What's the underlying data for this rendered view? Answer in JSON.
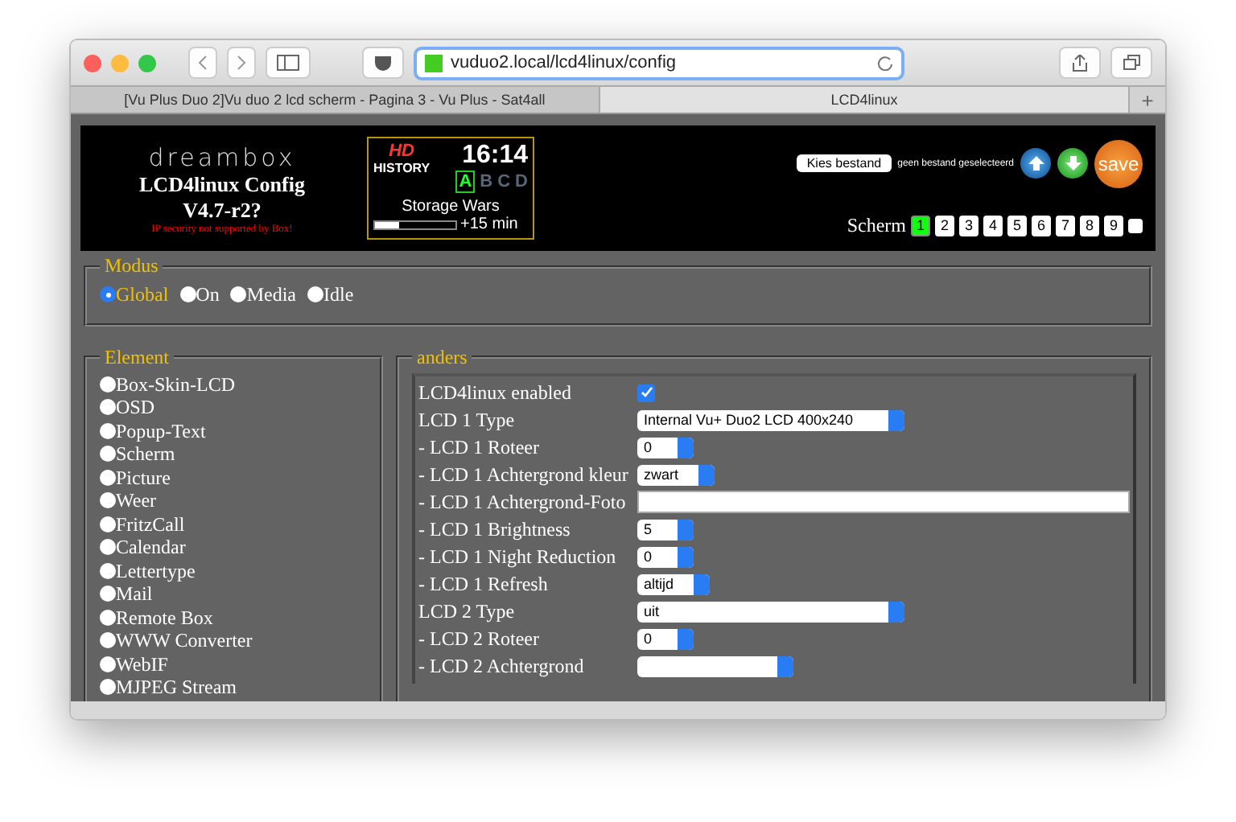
{
  "browser": {
    "url": "vuduo2.local/lcd4linux/config",
    "tabs": [
      {
        "label": "[Vu Plus Duo 2]Vu duo 2 lcd scherm - Pagina 3 - Vu Plus - Sat4all",
        "selected": false
      },
      {
        "label": "LCD4linux",
        "selected": true
      }
    ],
    "new_tab": "+"
  },
  "header": {
    "logo": "dreambox",
    "title": "LCD4linux Config",
    "version": "V4.7-r2?",
    "warning": "IP security not supported by Box!",
    "preview": {
      "channel_logo": "HD",
      "channel_name": "HISTORY",
      "time": "16:14",
      "letters": [
        {
          "label": "A",
          "selected": true
        },
        {
          "label": "B",
          "selected": false
        },
        {
          "label": "C",
          "selected": false
        },
        {
          "label": "D",
          "selected": false
        }
      ],
      "program": "Storage Wars",
      "level": 0.3,
      "remaining": "+15 min"
    },
    "file_button": "Kies bestand",
    "file_status": "geen bestand geselecteerd",
    "save": "save",
    "screen_label": "Scherm",
    "screens": [
      {
        "label": "1",
        "selected": true
      },
      {
        "label": "2",
        "selected": false
      },
      {
        "label": "3",
        "selected": false
      },
      {
        "label": "4",
        "selected": false
      },
      {
        "label": "5",
        "selected": false
      },
      {
        "label": "6",
        "selected": false
      },
      {
        "label": "7",
        "selected": false
      },
      {
        "label": "8",
        "selected": false
      },
      {
        "label": "9",
        "selected": false
      }
    ],
    "screen_check": false
  },
  "modus": {
    "legend": "Modus",
    "options": [
      {
        "label": "Global",
        "selected": true
      },
      {
        "label": "On",
        "selected": false
      },
      {
        "label": "Media",
        "selected": false
      },
      {
        "label": "Idle",
        "selected": false
      }
    ]
  },
  "element": {
    "legend": "Element",
    "options": [
      {
        "label": "Box-Skin-LCD",
        "selected": false
      },
      {
        "label": "OSD",
        "selected": false
      },
      {
        "label": "Popup-Text",
        "selected": false
      },
      {
        "label": "Scherm",
        "selected": false
      },
      {
        "label": "Picture",
        "selected": false
      },
      {
        "label": "Weer",
        "selected": false
      },
      {
        "label": "FritzCall",
        "selected": false
      },
      {
        "label": "Calendar",
        "selected": false
      },
      {
        "label": "Lettertype",
        "selected": false
      },
      {
        "label": "Mail",
        "selected": false
      },
      {
        "label": "Remote Box",
        "selected": false
      },
      {
        "label": "WWW Converter",
        "selected": false
      },
      {
        "label": "WebIF",
        "selected": false
      },
      {
        "label": "MJPEG Stream",
        "selected": false
      }
    ]
  },
  "anders": {
    "legend": "anders",
    "rows": [
      {
        "label": "LCD4linux enabled",
        "kind": "checkbox",
        "checked": true
      },
      {
        "label": "LCD 1 Type",
        "kind": "wideselect",
        "value": "Internal Vu+ Duo2 LCD 400x240"
      },
      {
        "label": "- LCD 1 Roteer",
        "kind": "select",
        "value": "0"
      },
      {
        "label": "- LCD 1 Achtergrond kleur",
        "kind": "select",
        "value": "zwart"
      },
      {
        "label": "- LCD 1 Achtergrond-Foto",
        "kind": "text"
      },
      {
        "label": "- LCD 1 Brightness",
        "kind": "select",
        "value": "5"
      },
      {
        "label": "- LCD 1 Night Reduction",
        "kind": "select",
        "value": "0"
      },
      {
        "label": "- LCD 1 Refresh",
        "kind": "select",
        "value": "altijd"
      },
      {
        "label": "LCD 2 Type",
        "kind": "wideselect",
        "value": "uit"
      },
      {
        "label": "- LCD 2 Roteer",
        "kind": "select",
        "value": "0"
      },
      {
        "label": "- LCD 2 Achtergrond",
        "kind": "select"
      }
    ]
  }
}
